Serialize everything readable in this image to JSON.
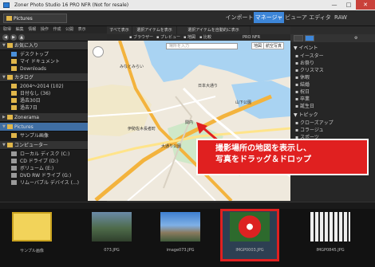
{
  "window": {
    "title": "Zoner Photo Studio 16 PRO NFR (Not for resale)",
    "min": "—",
    "max": "□",
    "close": "✕"
  },
  "toolbar": {
    "location": "Pictures",
    "modes": [
      "インポート",
      "マネージャ",
      "ビューア",
      "エディタ",
      "RAW"
    ],
    "active_mode": "マネージャ"
  },
  "menu": [
    "取得",
    "編集",
    "情報",
    "操作",
    "作成",
    "公開",
    "表示"
  ],
  "sidebar": {
    "favorites": {
      "label": "お気に入り",
      "items": [
        "デスクトップ",
        "マイ ドキュメント",
        "Downloads"
      ]
    },
    "catalog": {
      "label": "カタログ",
      "items": [
        "2004～2014 (102)",
        "日付なし (36)",
        "過去30日",
        "過去7日"
      ]
    },
    "zonerama": "Zonerama",
    "pictures": {
      "label": "Pictures",
      "items": [
        "サンプル画像"
      ]
    },
    "computer": {
      "label": "コンピューター",
      "items": [
        "ローカル ディスク (C:)",
        "CD ドライブ (D:)",
        "ボリューム (E:)",
        "DVD RW ドライブ (G:)",
        "リムーバブル デバイス (...)"
      ]
    }
  },
  "tabs": [
    "すべて表示",
    "選択アイテムを表示",
    "選択アイテムを自動的に表示"
  ],
  "map_tools": {
    "browser": "ブラウザー",
    "preview": "プレビュー",
    "map": "地図",
    "compare": "比較",
    "pro": "PRO NFR"
  },
  "map": {
    "search_placeholder": "場所を入力",
    "map_btn": "地図",
    "satellite_btn": "航空写真",
    "labels": [
      "日本大通り",
      "みなとみらい",
      "山下公園",
      "関内",
      "伊勢佐木長者町",
      "大通り公園"
    ]
  },
  "callout": {
    "line1": "撮影場所の地図を表示し、",
    "line2": "写真をドラッグ＆ドロップ"
  },
  "right_panel": {
    "header": "タグ",
    "groups": [
      {
        "label": "イベント",
        "items": [
          "イースター",
          "お祭り",
          "クリスマス",
          "休暇",
          "結婚",
          "祝日",
          "卒業",
          "誕生日"
        ]
      },
      {
        "label": "トピック",
        "items": [
          "クローズアップ",
          "コラージュ",
          "スポーツ"
        ]
      }
    ]
  },
  "thumbnails": [
    "サンプル画像",
    "073.JPG",
    "image073.JPG",
    "IMGP0003.JPG",
    "IMGP0845.JPG"
  ],
  "colors": {
    "accent": "#3d86d8",
    "highlight": "#e02020"
  }
}
